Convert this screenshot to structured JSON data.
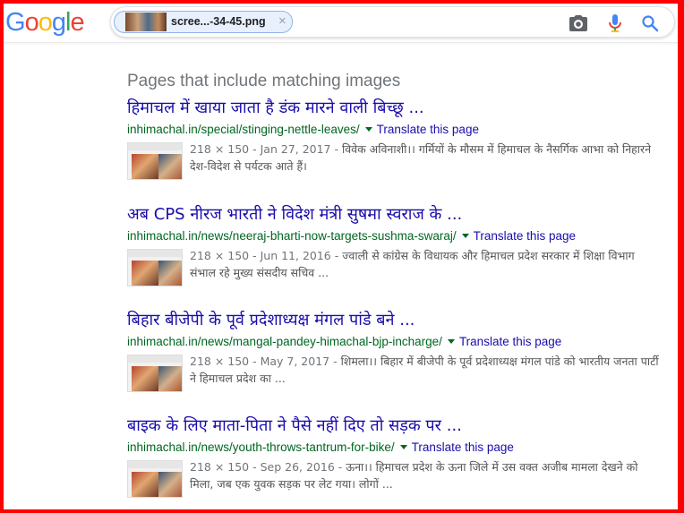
{
  "header": {
    "logo_letters": [
      {
        "char": "G",
        "color": "#4285F4"
      },
      {
        "char": "o",
        "color": "#EA4335"
      },
      {
        "char": "o",
        "color": "#FBBC05"
      },
      {
        "char": "g",
        "color": "#4285F4"
      },
      {
        "char": "l",
        "color": "#34A853"
      },
      {
        "char": "e",
        "color": "#EA4335"
      }
    ],
    "search": {
      "chip_filename": "scree...-34-45.png",
      "chip_close": "×",
      "icons": [
        "camera-icon",
        "microphone-icon",
        "search-icon"
      ]
    }
  },
  "main": {
    "section_title": "Pages that include matching images",
    "results": [
      {
        "title": "हिमाचल में खाया जाता है डंक मारने वाली बिच्छू ...",
        "url": "inhimachal.in/special/stinging-nettle-leaves/",
        "translate": "Translate this page",
        "meta": "218 × 150 - Jan 27, 2017 - ",
        "snippet_line1": "विवेक अविनाशी।। गर्मियों के मौसम में हिमाचल के नैसर्गिक आभा को निहारने",
        "snippet_line2": "देश-विदेश से पर्यटक आते हैं।"
      },
      {
        "title": "अब CPS नीरज भारती ने विदेश मंत्री सुषमा स्वराज के ...",
        "url": "inhimachal.in/news/neeraj-bharti-now-targets-sushma-swaraj/",
        "translate": "Translate this page",
        "meta": "218 × 150 - Jun 11, 2016 - ",
        "snippet_line1": "ज्वाली से कांग्रेस के विधायक और हिमाचल प्रदेश सरकार में शिक्षा विभाग",
        "snippet_line2": "संभाल रहे मुख्य संसदीय सचिव ..."
      },
      {
        "title": "बिहार बीजेपी के पूर्व प्रदेशाध्यक्ष मंगल पांडे बने ...",
        "url": "inhimachal.in/news/mangal-pandey-himachal-bjp-incharge/",
        "translate": "Translate this page",
        "meta": "218 × 150 - May 7, 2017 - ",
        "snippet_line1": "शिमला।। बिहार में बीजेपी के पूर्व प्रदेशाध्यक्ष मंगल पांडे को भारतीय जनता पार्टी",
        "snippet_line2": "ने हिमाचल प्रदेश का ..."
      },
      {
        "title": "बाइक के लिए माता-पिता ने पैसे नहीं दिए तो सड़क पर ...",
        "url": "inhimachal.in/news/youth-throws-tantrum-for-bike/",
        "translate": "Translate this page",
        "meta": "218 × 150 - Sep 26, 2016 - ",
        "snippet_line1": "ऊना।। हिमाचल प्रदेश के ऊना जिले में उस वक्त अजीब मामला देखने को",
        "snippet_line2": "मिला, जब एक युवक सड़क पर लेट गया। लोगों ..."
      }
    ]
  },
  "colors": {
    "frame_border": "#FF0000",
    "link": "#1A0DAB",
    "url": "#006621",
    "snippet": "#545454",
    "section_title": "#70757A"
  }
}
